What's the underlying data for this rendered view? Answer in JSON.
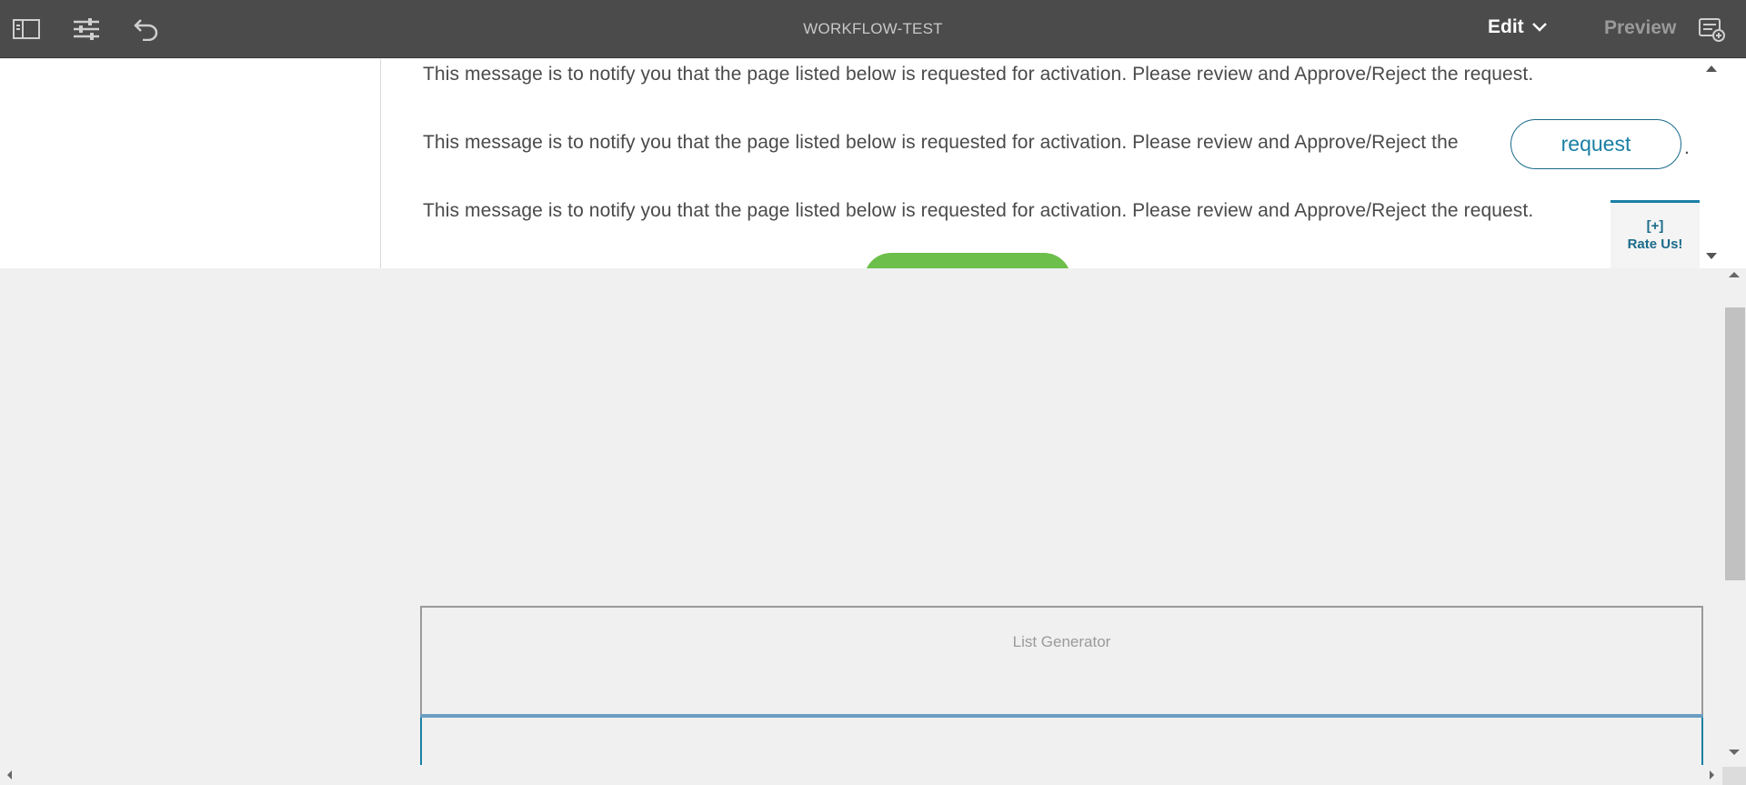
{
  "toolbar": {
    "title": "WORKFLOW-TEST",
    "edit_label": "Edit",
    "preview_label": "Preview",
    "icons": [
      "side-panel-icon",
      "page-properties-icon",
      "undo-icon",
      "chevron-down-icon",
      "annotations-icon"
    ]
  },
  "content": {
    "message_1": "This message is to notify you that the page listed below is requested for activation. Please review and Approve/Reject the request.",
    "message_2": "This message is to notify you that the page listed below is requested for activation. Please review and Approve/Reject the",
    "message_2_button": "request",
    "message_2_suffix": ".",
    "message_3": "This message is to notify you that the page listed below is requested for activation. Please review and Approve/Reject the request.",
    "rate_us_line1": "[+]",
    "rate_us_line2": "Rate Us!"
  },
  "component": {
    "list_generator_label": "List Generator"
  },
  "colors": {
    "toolbar_bg": "#4b4b4b",
    "accent": "#1a7fa5",
    "green": "#6cbf4a"
  }
}
